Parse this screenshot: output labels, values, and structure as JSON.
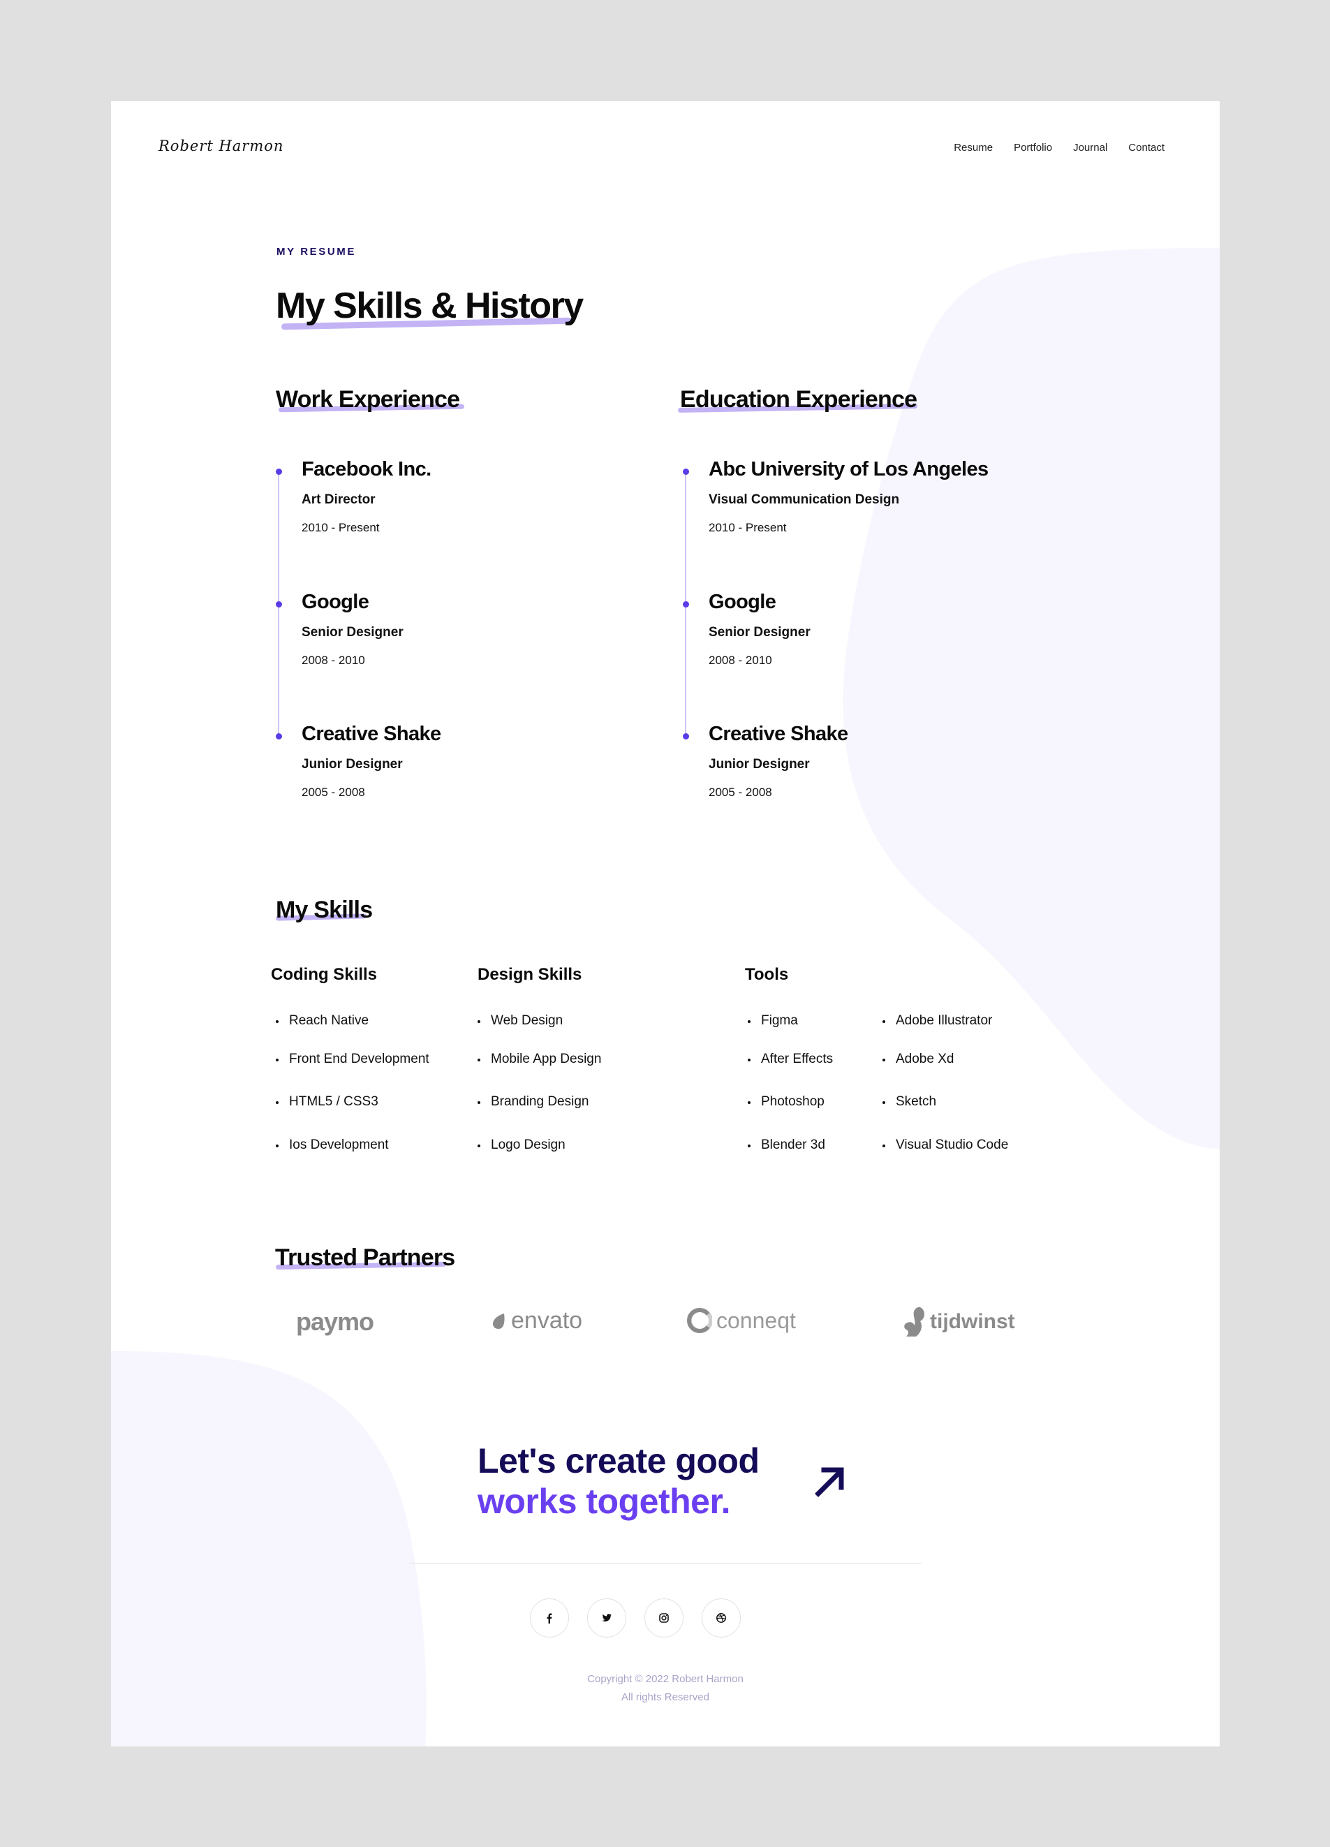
{
  "header": {
    "logo": "Robert Harmon",
    "nav": [
      "Resume",
      "Portfolio",
      "Journal",
      "Contact"
    ]
  },
  "intro": {
    "eyebrow": "MY RESUME",
    "title": "My Skills & History"
  },
  "work": {
    "title": "Work Experience",
    "items": [
      {
        "company": "Facebook Inc.",
        "role": "Art Director",
        "dates": "2010 - Present"
      },
      {
        "company": "Google",
        "role": "Senior Designer",
        "dates": "2008 - 2010"
      },
      {
        "company": "Creative Shake",
        "role": "Junior Designer",
        "dates": "2005 - 2008"
      }
    ]
  },
  "education": {
    "title": "Education Experience",
    "items": [
      {
        "company": "Abc University of Los Angeles",
        "role": "Visual Communication Design",
        "dates": "2010 - Present"
      },
      {
        "company": "Google",
        "role": "Senior Designer",
        "dates": "2008 - 2010"
      },
      {
        "company": "Creative Shake",
        "role": "Junior Designer",
        "dates": "2005 - 2008"
      }
    ]
  },
  "skills": {
    "title": "My Skills",
    "coding": {
      "title": "Coding Skills",
      "items": [
        "Reach Native",
        "Front End Development",
        "HTML5 / CSS3",
        "Ios Development"
      ]
    },
    "design": {
      "title": "Design Skills",
      "items": [
        "Web Design",
        "Mobile App Design",
        "Branding Design",
        "Logo Design"
      ]
    },
    "tools": {
      "title": "Tools",
      "col1": [
        "Figma",
        "After Effects",
        "Photoshop",
        "Blender 3d"
      ],
      "col2": [
        "Adobe Illustrator",
        "Adobe Xd",
        "Sketch",
        "Visual Studio Code"
      ]
    }
  },
  "partners": {
    "title": "Trusted Partners",
    "logos": [
      "paymo",
      "envato",
      "conneqt",
      "tijdwinst"
    ]
  },
  "cta": {
    "line1": "Let's create good",
    "line2": "works together."
  },
  "social": [
    "facebook-icon",
    "twitter-icon",
    "instagram-icon",
    "dribbble-icon"
  ],
  "footer": {
    "copyright": "Copyright © 2022 Robert Harmon",
    "rights": "All rights Reserved"
  },
  "colors": {
    "accent": "#6a3ff0",
    "dark_navy": "#140c57",
    "underline": "#b9a6f3",
    "blob": "#f7f6fe"
  }
}
